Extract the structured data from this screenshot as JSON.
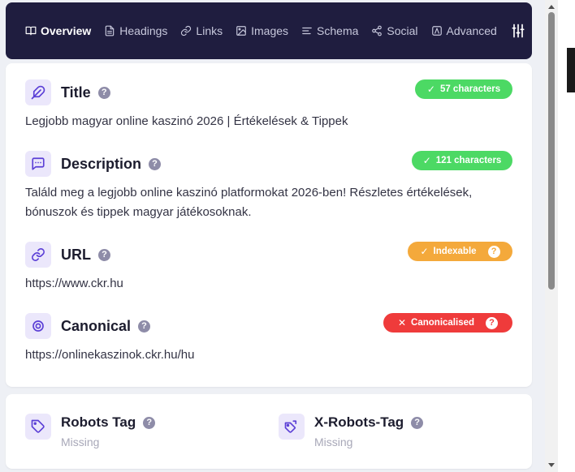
{
  "nav": {
    "tabs": [
      {
        "label": "Overview",
        "icon": "book-open-icon"
      },
      {
        "label": "Headings",
        "icon": "file-text-icon"
      },
      {
        "label": "Links",
        "icon": "link-icon"
      },
      {
        "label": "Images",
        "icon": "image-icon"
      },
      {
        "label": "Schema",
        "icon": "align-left-icon"
      },
      {
        "label": "Social",
        "icon": "share-icon"
      },
      {
        "label": "Advanced",
        "icon": "advanced-icon"
      }
    ],
    "active_tab": "Overview",
    "settings_icon": "sliders-icon"
  },
  "fields": {
    "title": {
      "label": "Title",
      "value": "Legjobb magyar online kaszinó 2026 | Értékelések & Tippek",
      "badge": "57 characters",
      "badge_color": "#4cd964"
    },
    "description": {
      "label": "Description",
      "value": "Találd meg a legjobb online kaszinó platformokat 2026-ben! Részletes értékelések, bónuszok és tippek magyar játékosoknak.",
      "badge": "121 characters",
      "badge_color": "#4cd964"
    },
    "url": {
      "label": "URL",
      "value": "https://www.ckr.hu",
      "badge": "Indexable",
      "badge_color": "#f4a93b"
    },
    "canonical": {
      "label": "Canonical",
      "value": "https://onlinekaszinok.ckr.hu/hu",
      "badge": "Canonicalised",
      "badge_color": "#ef3b3b"
    }
  },
  "robots": {
    "robots_tag": {
      "label": "Robots Tag",
      "status": "Missing"
    },
    "x_robots_tag": {
      "label": "X-Robots-Tag",
      "status": "Missing"
    }
  },
  "help_symbol": "?",
  "check_symbol": "✓",
  "cross_symbol": "✕",
  "colors": {
    "nav_bg": "#1f1d3f",
    "accent": "#5b3fd6",
    "icon_bg": "#ebe7fb"
  }
}
